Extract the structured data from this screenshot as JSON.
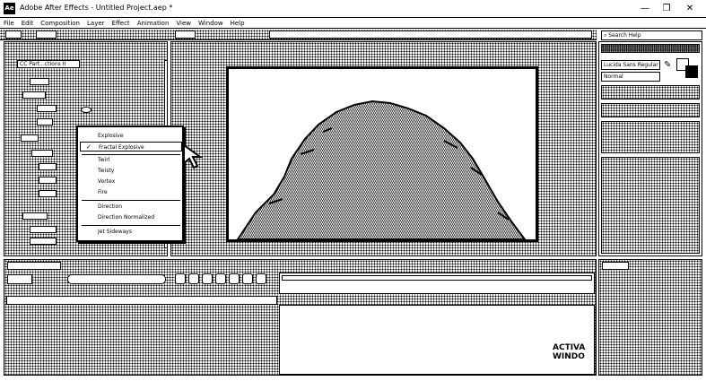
{
  "app": {
    "title": "Adobe After Effects - Untitled Project.aep *",
    "icon_label": "Ae"
  },
  "window_controls": {
    "minimize": "—",
    "maximize": "❐",
    "close": "✕"
  },
  "menu": [
    "File",
    "Edit",
    "Composition",
    "Layer",
    "Effect",
    "Animation",
    "View",
    "Window",
    "Help"
  ],
  "search": {
    "placeholder": "Search Help"
  },
  "effects_panel": {
    "header": "CC Part...ctions II"
  },
  "context_menu": {
    "items": [
      "Explosive",
      "Fractal Explosive",
      "Twirl",
      "Twisty",
      "Vortex",
      "Fire",
      "Direction",
      "Direction Normalized",
      "Jet Sideways"
    ],
    "checked": "Fractal Explosive"
  },
  "character_panel": {
    "font": "Lucida Sans Regular",
    "style": "Normal"
  },
  "watermark": {
    "line1": "ACTIVA",
    "line2": "WINDO"
  },
  "icons": {
    "color_picker": "eyedropper-icon",
    "swap": "swap-colors-icon"
  }
}
